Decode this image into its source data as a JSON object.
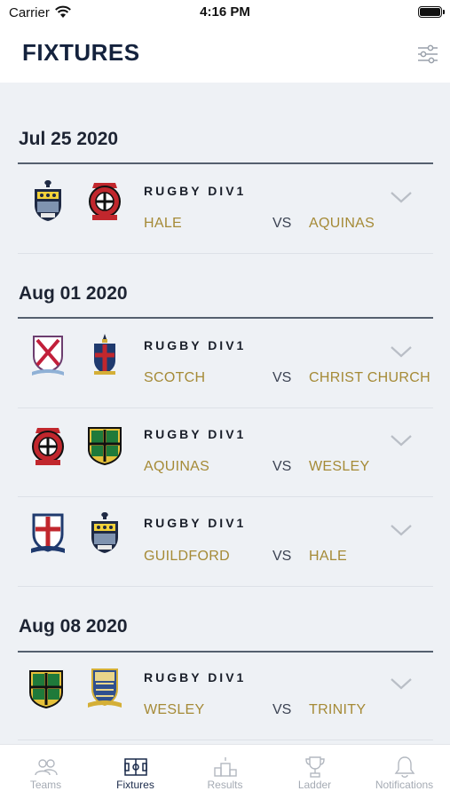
{
  "status": {
    "carrier": "Carrier",
    "time": "4:16 PM"
  },
  "header": {
    "title": "FIXTURES"
  },
  "dates": [
    {
      "label": "Jul 25 2020"
    },
    {
      "label": "Aug 01 2020"
    },
    {
      "label": "Aug 08 2020"
    }
  ],
  "fixtures": [
    {
      "division": "RUGBY DIV1",
      "home": "HALE",
      "vs": "VS",
      "away": "AQUINAS"
    },
    {
      "division": "RUGBY DIV1",
      "home": "SCOTCH",
      "vs": "VS",
      "away": "CHRIST CHURCH"
    },
    {
      "division": "RUGBY DIV1",
      "home": "AQUINAS",
      "vs": "VS",
      "away": "WESLEY"
    },
    {
      "division": "RUGBY DIV1",
      "home": "GUILDFORD",
      "vs": "VS",
      "away": "HALE"
    },
    {
      "division": "RUGBY DIV1",
      "home": "WESLEY",
      "vs": "VS",
      "away": "TRINITY"
    }
  ],
  "tabs": [
    {
      "label": "Teams"
    },
    {
      "label": "Fixtures"
    },
    {
      "label": "Results"
    },
    {
      "label": "Ladder"
    },
    {
      "label": "Notifications"
    }
  ],
  "active_tab": "Fixtures",
  "colors": {
    "title": "#14223d",
    "team_name": "#a58a36",
    "active_tab": "#1a2a4a",
    "inactive_tab": "#a5abb4"
  }
}
